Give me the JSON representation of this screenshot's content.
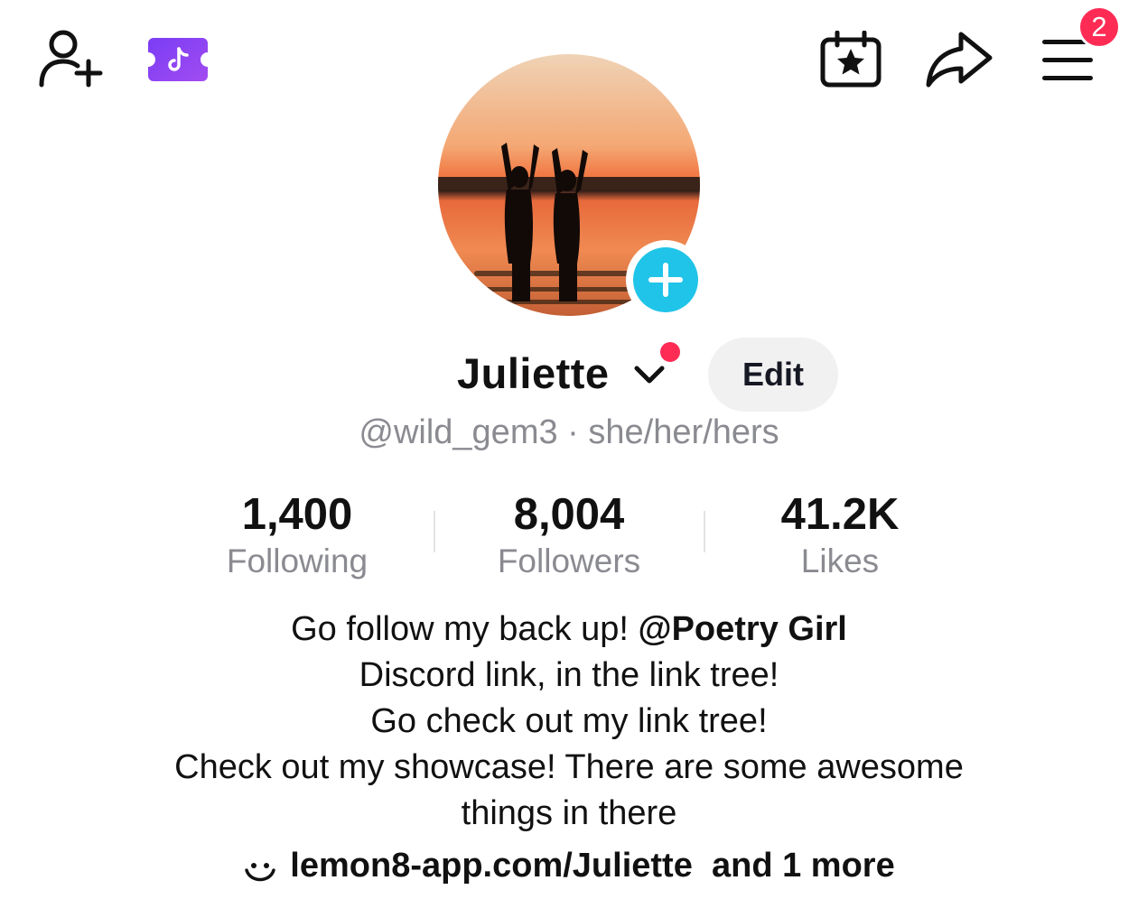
{
  "top_bar": {
    "add_friend_icon": "person-plus-icon",
    "ticket_icon": "tiktok-ticket-icon",
    "calendar_icon": "calendar-star-icon",
    "share_icon": "share-arrow-icon",
    "menu_icon": "hamburger-menu-icon",
    "notification_count": "2"
  },
  "profile": {
    "avatar": "sunset-silhouette-avatar",
    "add_avatar_icon": "plus-icon",
    "name": "Juliette",
    "handle": "@wild_gem3",
    "separator": "·",
    "pronouns": "she/her/hers",
    "edit_label": "Edit"
  },
  "stats": [
    {
      "value": "1,400",
      "label": "Following"
    },
    {
      "value": "8,004",
      "label": "Followers"
    },
    {
      "value": "41.2K",
      "label": "Likes"
    }
  ],
  "bio": {
    "line1_text": "Go follow my back up! ",
    "line1_mention": "@Poetry Girl",
    "line2": "Discord link, in the link tree!",
    "line3": "Go check out my link tree!",
    "line4": "Check out my showcase! There are some awesome",
    "line5": "things in there"
  },
  "link": {
    "icon": "link-icon",
    "url": "lemon8-app.com/Juliette",
    "more": "and 1 more"
  },
  "colors": {
    "accent_red": "#fe2c55",
    "accent_cyan": "#20c4e8",
    "ticket_purple": "#8a3cf0",
    "muted_text": "#8a8b91"
  }
}
